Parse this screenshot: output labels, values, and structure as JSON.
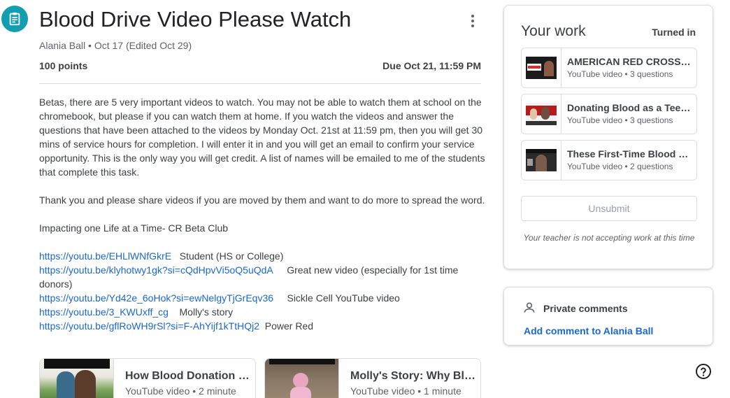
{
  "assignment": {
    "title": "Blood Drive Video Please Watch",
    "meta": "Alania Ball • Oct 17 (Edited Oct 29)",
    "points": "100 points",
    "due": "Due Oct 21, 11:59 PM",
    "paragraphs": [
      "Betas, there are 5 very important videos to watch. You may not be able to watch them at school on the chromebook, but please if you can watch them at home. If you watch the videos and answer the questions that have been attached to the videos by Monday Oct. 21st at 11:59 pm, then you will get 30 mins of service hours for completion. I will enter it in and you will get an email to confirm your service opportunity. This is the only way you will get credit. A list of names will be emailed to me of the students that complete this task.",
      "Thank you and please share videos if you are moved by them and want to do more to spread the word.",
      "Impacting one Life at a Time- CR Beta Club"
    ],
    "links": [
      {
        "url": "https://youtu.be/EHLlWNfGkrE",
        "label": "Student (HS or College)"
      },
      {
        "url": "https://youtu.be/klyhotwy1gk?si=cQdHpvVi5oQ5uQdA",
        "label": "Great new video (especially for 1st time donors)"
      },
      {
        "url": "https://youtu.be/Yd42e_6oHok?si=ewNelgyTjGrEqv36",
        "label": "Sickle Cell YouTube video"
      },
      {
        "url": "https://youtu.be/3_KWUxff_cg",
        "label": "Molly's story"
      },
      {
        "url": "https://youtu.be/gflRoWH9rSl?si=F-AhYijf1kTtHQj2",
        "label": "Power Red"
      }
    ],
    "attachments": [
      {
        "title": "How Blood Donation Saves Lives",
        "subtitle": "YouTube video • 2 minute"
      },
      {
        "title": "Molly's Story: Why Blood Donation Matters",
        "subtitle": "YouTube video • 1 minute"
      }
    ]
  },
  "your_work": {
    "title": "Your work",
    "status": "Turned in",
    "attachments": [
      {
        "title": "AMERICAN RED CROSS BLOOD DONATION",
        "subtitle": "YouTube video • 3 questions"
      },
      {
        "title": "Donating Blood as a Teenager",
        "subtitle": "YouTube video • 3 questions"
      },
      {
        "title": "These First-Time Blood Donors",
        "subtitle": "YouTube video • 2 questions"
      }
    ],
    "unsubmit_label": "Unsubmit",
    "note": "Your teacher is not accepting work at this time"
  },
  "private_comments": {
    "title": "Private comments",
    "add_label": "Add comment to Alania Ball"
  },
  "colors": {
    "accent": "#129eaf",
    "link": "#1967d2",
    "border": "#dadce0"
  }
}
